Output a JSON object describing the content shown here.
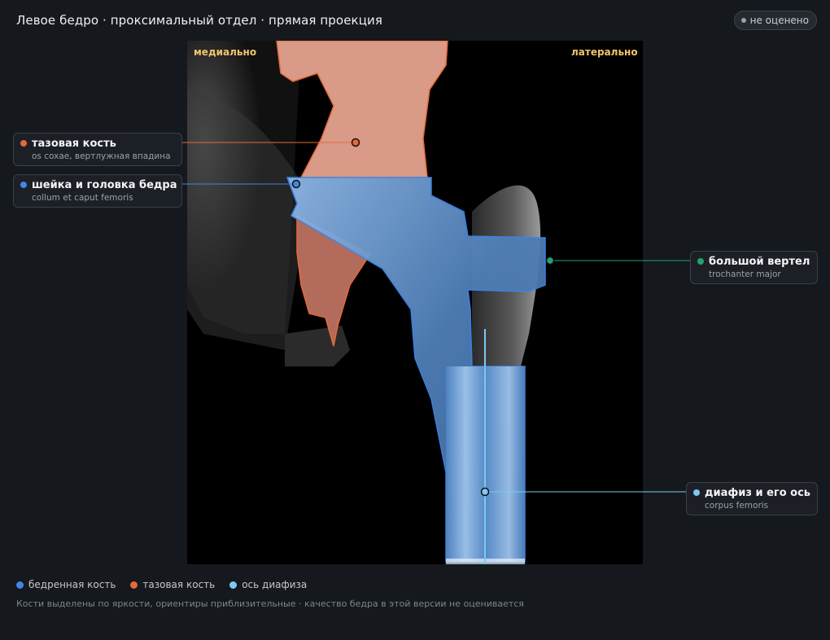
{
  "header": {
    "title": "Левое бедро · проксимальный отдел · прямая проекция",
    "status_badge": "не оценено"
  },
  "viewer": {
    "orientation_left": "медиально",
    "orientation_right": "латерально"
  },
  "callouts": [
    {
      "id": "pelvis",
      "name": "тазовая кость",
      "latin": "os coxae, вертлужная впадина",
      "color": "#e36a3c"
    },
    {
      "id": "neck",
      "name": "шейка и головка бедра",
      "latin": "collum et caput femoris",
      "color": "#3f86e6"
    },
    {
      "id": "trochanter",
      "name": "большой вертел",
      "latin": "trochanter major",
      "color": "#22a36f"
    },
    {
      "id": "shaft",
      "name": "диафиз и его ось",
      "latin": "corpus femoris",
      "color": "#7cc8f2"
    }
  ],
  "legend": [
    {
      "label": "бедренная кость",
      "color": "#3f86e6"
    },
    {
      "label": "тазовая кость",
      "color": "#e36a3c"
    },
    {
      "label": "ось диафиза",
      "color": "#7cc8f2"
    }
  ],
  "footer_note": "Кости выделены по яркости, ориентиры приблизительные · качество бедра в этой версии не оценивается"
}
